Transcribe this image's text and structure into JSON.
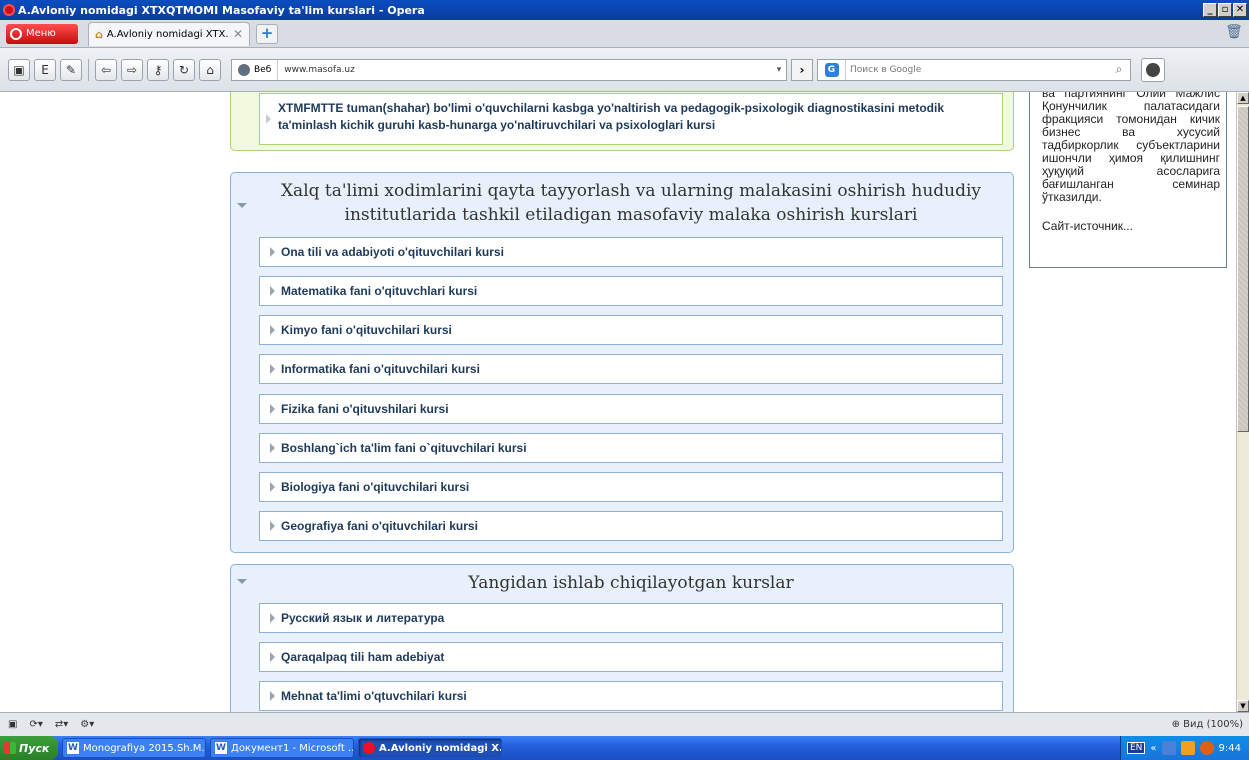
{
  "window": {
    "title": "A.Avloniy nomidagi XTXQTMOMI Masofaviy ta'lim kurslari - Opera",
    "controls": [
      "_",
      "▫",
      "✕"
    ]
  },
  "tabbar": {
    "menu_label": "Меню",
    "tab_title": "A.Avloniy nomidagi XTX...",
    "tab_close": "✕",
    "new_tab": "+"
  },
  "navbar": {
    "web_label": "Веб",
    "url": "www.masofa.uz",
    "search_placeholder": "Поиск в Google"
  },
  "content": {
    "green_item": "XTMFMTTE tuman(shahar) bo'limi o'quvchilarni kasbga yo'naltirish va pedagogik-psixologik diagnostikasini metodik ta'minlash kichik guruhi kasb-hunarga yo'naltiruvchilari va psixologlari kursi",
    "section1": {
      "heading": "Xalq ta'limi xodimlarini qayta tayyorlash va ularning malakasini oshirish hududiy institutlarida tashkil etiladigan masofaviy malaka oshirish kurslari",
      "items": [
        "Ona tili va adabiyoti o'qituvchilari kursi",
        "Matematika fani o'qituvchlari kursi",
        "Kimyo fani o'qituvchilari kursi",
        "Informatika fani o'qituvchilari kursi",
        "Fizika fani o'qituvshilari kursi",
        "Boshlang`ich ta'lim fani o`qituvchilari kursi",
        "Biologiya fani o'qituvchilari kursi",
        "Geografiya fani o'qituvchilari kursi"
      ]
    },
    "section2": {
      "heading": "Yangidan ishlab chiqilayotgan kurslar",
      "items": [
        "Русский язык и литература",
        "Qaraqalpaq tili ham adebiyat",
        "Mehnat ta'limi o'qtuvchilari kursi"
      ]
    },
    "news": {
      "text": "ва партиянинг Олий Мажлис Қонунчилик палатасидаги фракцияси томонидан кичик бизнес ва хусусий тадбиркорлик субъектларини ишончли ҳимоя қилишнинг ҳуқуқий асосларига бағишланган семинар ўтказилди.",
      "source": "Сайт-источник..."
    }
  },
  "statusbar": {
    "zoom": "Вид (100%)"
  },
  "taskbar": {
    "start": "Пуск",
    "buttons": [
      "Monografiya 2015.Sh.M....",
      "Документ1 - Microsoft ...",
      "A.Avloniy nomidagi X..."
    ],
    "lang": "EN",
    "time": "9:44"
  }
}
